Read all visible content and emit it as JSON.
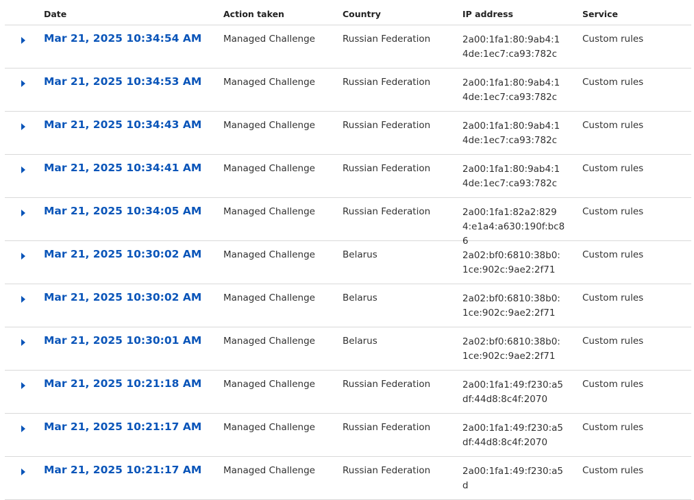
{
  "colors": {
    "link": "#0a55b9",
    "expand_icon": "#0a55b9",
    "divider": "#d9d9d9"
  },
  "table": {
    "headers": {
      "date": "Date",
      "action": "Action taken",
      "country": "Country",
      "ip": "IP address",
      "service": "Service"
    },
    "rows": [
      {
        "date": "Mar 21, 2025 10:34:54 AM",
        "action": "Managed Challenge",
        "country": "Russian Federation",
        "ip": "2a00:1fa1:80:9ab4:14de:1ec7:ca93:782c",
        "service": "Custom rules"
      },
      {
        "date": "Mar 21, 2025 10:34:53 AM",
        "action": "Managed Challenge",
        "country": "Russian Federation",
        "ip": "2a00:1fa1:80:9ab4:14de:1ec7:ca93:782c",
        "service": "Custom rules"
      },
      {
        "date": "Mar 21, 2025 10:34:43 AM",
        "action": "Managed Challenge",
        "country": "Russian Federation",
        "ip": "2a00:1fa1:80:9ab4:14de:1ec7:ca93:782c",
        "service": "Custom rules"
      },
      {
        "date": "Mar 21, 2025 10:34:41 AM",
        "action": "Managed Challenge",
        "country": "Russian Federation",
        "ip": "2a00:1fa1:80:9ab4:14de:1ec7:ca93:782c",
        "service": "Custom rules"
      },
      {
        "date": "Mar 21, 2025 10:34:05 AM",
        "action": "Managed Challenge",
        "country": "Russian Federation",
        "ip": "2a00:1fa1:82a2:8294:e1a4:a630:190f:bc86",
        "service": "Custom rules"
      },
      {
        "date": "Mar 21, 2025 10:30:02 AM",
        "action": "Managed Challenge",
        "country": "Belarus",
        "ip": "2a02:bf0:6810:38b0:1ce:902c:9ae2:2f71",
        "service": "Custom rules"
      },
      {
        "date": "Mar 21, 2025 10:30:02 AM",
        "action": "Managed Challenge",
        "country": "Belarus",
        "ip": "2a02:bf0:6810:38b0:1ce:902c:9ae2:2f71",
        "service": "Custom rules"
      },
      {
        "date": "Mar 21, 2025 10:30:01 AM",
        "action": "Managed Challenge",
        "country": "Belarus",
        "ip": "2a02:bf0:6810:38b0:1ce:902c:9ae2:2f71",
        "service": "Custom rules"
      },
      {
        "date": "Mar 21, 2025 10:21:18 AM",
        "action": "Managed Challenge",
        "country": "Russian Federation",
        "ip": "2a00:1fa1:49:f230:a5df:44d8:8c4f:2070",
        "service": "Custom rules"
      },
      {
        "date": "Mar 21, 2025 10:21:17 AM",
        "action": "Managed Challenge",
        "country": "Russian Federation",
        "ip": "2a00:1fa1:49:f230:a5df:44d8:8c4f:2070",
        "service": "Custom rules"
      },
      {
        "date": "Mar 21, 2025 10:21:17 AM",
        "action": "Managed Challenge",
        "country": "Russian Federation",
        "ip": "2a00:1fa1:49:f230:a5d",
        "service": "Custom rules"
      }
    ]
  }
}
